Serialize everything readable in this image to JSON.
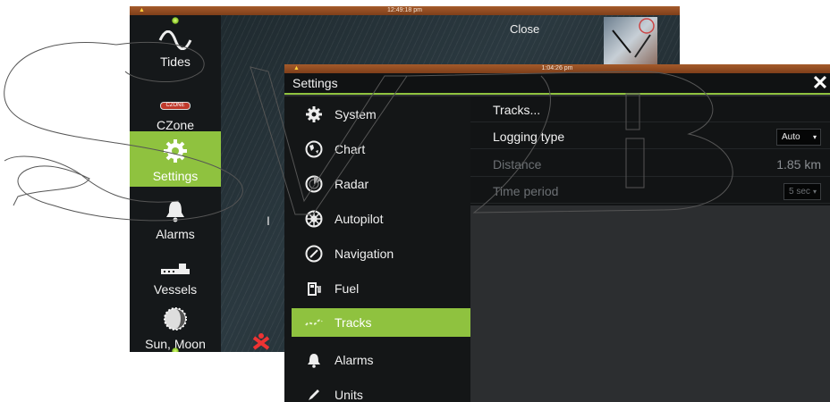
{
  "back_panel": {
    "status_time": "12:49:18 pm",
    "close_label": "Close",
    "partial_text": "I",
    "rail_items": [
      {
        "label": "Tides",
        "icon": "wave-icon"
      },
      {
        "label": "CZone",
        "icon": "czone-logo-icon"
      },
      {
        "label": "Settings",
        "icon": "gear-icon",
        "active": true
      },
      {
        "label": "Alarms",
        "icon": "bell-icon"
      },
      {
        "label": "Vessels",
        "icon": "ship-icon"
      },
      {
        "label": "Sun, Moon",
        "icon": "moon-icon"
      }
    ],
    "czone_logo_text": "CZONE"
  },
  "settings": {
    "status_time": "1:04:26 pm",
    "title": "Settings",
    "close_icon": "close-icon",
    "nav_items": [
      {
        "label": "System",
        "icon": "gear-icon"
      },
      {
        "label": "Chart",
        "icon": "globe-icon"
      },
      {
        "label": "Radar",
        "icon": "radar-icon"
      },
      {
        "label": "Autopilot",
        "icon": "helm-icon"
      },
      {
        "label": "Navigation",
        "icon": "compass-icon"
      },
      {
        "label": "Fuel",
        "icon": "fuel-pump-icon"
      },
      {
        "label": "Tracks",
        "icon": "track-icon",
        "active": true
      },
      {
        "label": "Alarms",
        "icon": "bell-icon"
      },
      {
        "label": "Units",
        "icon": "pencil-icon"
      }
    ],
    "rows": {
      "tracks_link": "Tracks...",
      "logging_type": {
        "label": "Logging type",
        "value": "Auto"
      },
      "distance": {
        "label": "Distance",
        "value": "1.85 km"
      },
      "time_period": {
        "label": "Time period",
        "value": "5 sec"
      }
    }
  },
  "colors": {
    "accent": "#8fc23f",
    "status_bar": "#a55a2a",
    "panel_bg": "#141617"
  }
}
